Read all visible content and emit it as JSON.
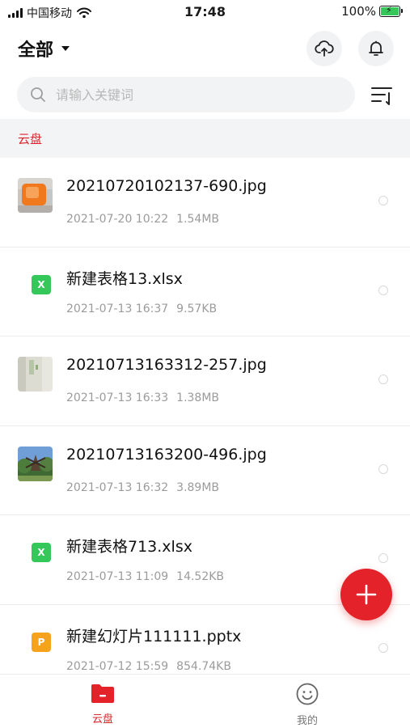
{
  "status_bar": {
    "carrier": "中国移动",
    "time": "17:48",
    "battery": "100%",
    "battery_level": 1.0
  },
  "header": {
    "title": "全部"
  },
  "search": {
    "placeholder": "请输入关键词"
  },
  "section": {
    "label": "云盘"
  },
  "files": [
    {
      "name": "20210720102137-690.jpg",
      "date": "2021-07-20 10:22",
      "size": "1.54MB",
      "kind": "image"
    },
    {
      "name": "新建表格13.xlsx",
      "date": "2021-07-13 16:37",
      "size": "9.57KB",
      "kind": "xlsx",
      "badge": "X"
    },
    {
      "name": "20210713163312-257.jpg",
      "date": "2021-07-13 16:33",
      "size": "1.38MB",
      "kind": "image"
    },
    {
      "name": "20210713163200-496.jpg",
      "date": "2021-07-13 16:32",
      "size": "3.89MB",
      "kind": "image"
    },
    {
      "name": "新建表格713.xlsx",
      "date": "2021-07-13 11:09",
      "size": "14.52KB",
      "kind": "xlsx",
      "badge": "X"
    },
    {
      "name": "新建幻灯片111111.pptx",
      "date": "2021-07-12 15:59",
      "size": "854.74KB",
      "kind": "pptx",
      "badge": "P"
    }
  ],
  "bottom_nav": {
    "items": [
      {
        "label": "云盘",
        "icon": "cloud-folder-icon",
        "active": true
      },
      {
        "label": "我的",
        "icon": "smiley-icon",
        "active": false
      }
    ]
  },
  "colors": {
    "accent": "#e3222a",
    "xlsx": "#34c759",
    "pptx": "#f7a21b"
  }
}
